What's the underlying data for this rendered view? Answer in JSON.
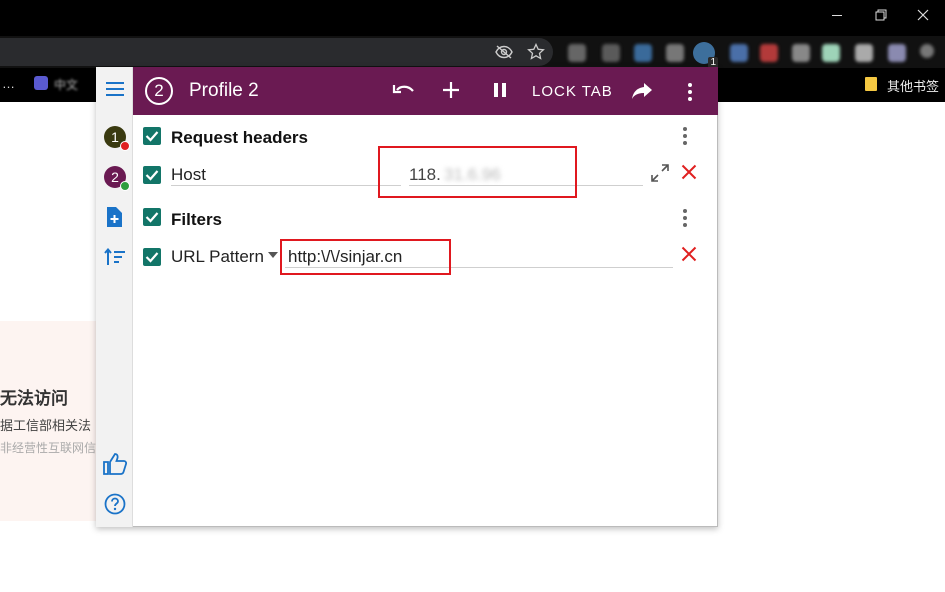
{
  "browser": {
    "window_controls": {
      "minimize": "—",
      "restore": "❐",
      "close": "✕"
    },
    "bookmarks_bar": {
      "left_item": "…",
      "tab_label": "中文",
      "other_bookmarks": "其他书签"
    },
    "extension_badge": "1"
  },
  "page": {
    "heading": "无法访问",
    "line1": "据工信部相关法",
    "line2": "非经营性互联网信"
  },
  "popup": {
    "header": {
      "profile_number": "2",
      "title": "Profile 2",
      "lock_tab_label": "LOCK TAB"
    },
    "sidebar": {
      "profiles": [
        {
          "number": "1",
          "color": "#3a3a10",
          "status_color": "#e02020"
        },
        {
          "number": "2",
          "color": "#6a1a52",
          "status_color": "#2e9e3e"
        }
      ]
    },
    "sections": {
      "request_headers": {
        "title": "Request headers",
        "rows": [
          {
            "name": "Host",
            "value": "118.",
            "value_blurred": "31.6.96"
          }
        ]
      },
      "filters": {
        "title": "Filters",
        "rows": [
          {
            "type": "URL Pattern",
            "value": "http:\\/\\/sinjar.cn"
          }
        ]
      }
    },
    "accent_color": "#6a1a52",
    "checkbox_color": "#127568",
    "highlight_color": "#e0181f"
  }
}
